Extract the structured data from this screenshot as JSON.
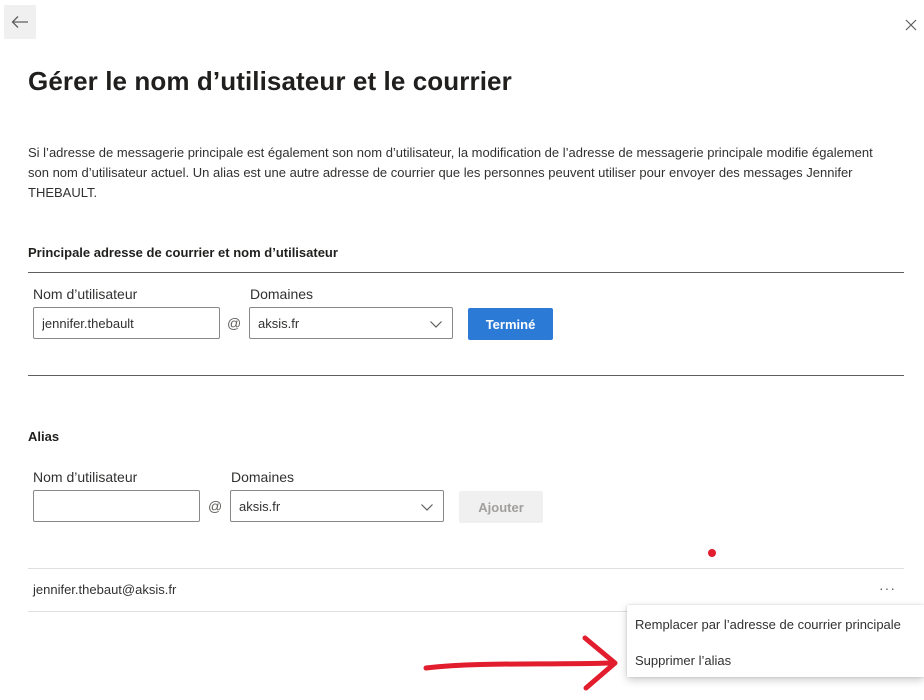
{
  "header": {
    "title": "Gérer le nom d’utilisateur et le courrier",
    "description": "Si l’adresse de messagerie principale est également son nom d’utilisateur, la modification de l’adresse de messagerie principale modifie également son nom d’utilisateur actuel. Un alias est une autre adresse de courrier que les personnes peuvent utiliser pour envoyer des messages Jennifer THEBAULT."
  },
  "primary": {
    "section_title": "Principale adresse de courrier et nom d’utilisateur",
    "username_label": "Nom d’utilisateur",
    "username_value": "jennifer.thebault",
    "at_sign": "@",
    "domains_label": "Domaines",
    "domain_value": "aksis.fr",
    "done_button": "Terminé"
  },
  "alias": {
    "section_title": "Alias",
    "username_label": "Nom d’utilisateur",
    "username_value": "",
    "at_sign": "@",
    "domains_label": "Domaines",
    "domain_value": "aksis.fr",
    "add_button": "Ajouter",
    "items": [
      {
        "email": "jennifer.thebaut@aksis.fr",
        "more": "···"
      }
    ]
  },
  "context_menu": {
    "items": [
      {
        "label": "Remplacer par l’adresse de courrier principale"
      },
      {
        "label": "Supprimer l’alias"
      }
    ]
  },
  "colors": {
    "accent": "#2b7bd6",
    "annotation": "#e11d2e"
  },
  "icons": {
    "back": "back-arrow-icon",
    "close": "close-icon",
    "dropdown": "chevron-down-icon",
    "more": "more-options-icon"
  }
}
